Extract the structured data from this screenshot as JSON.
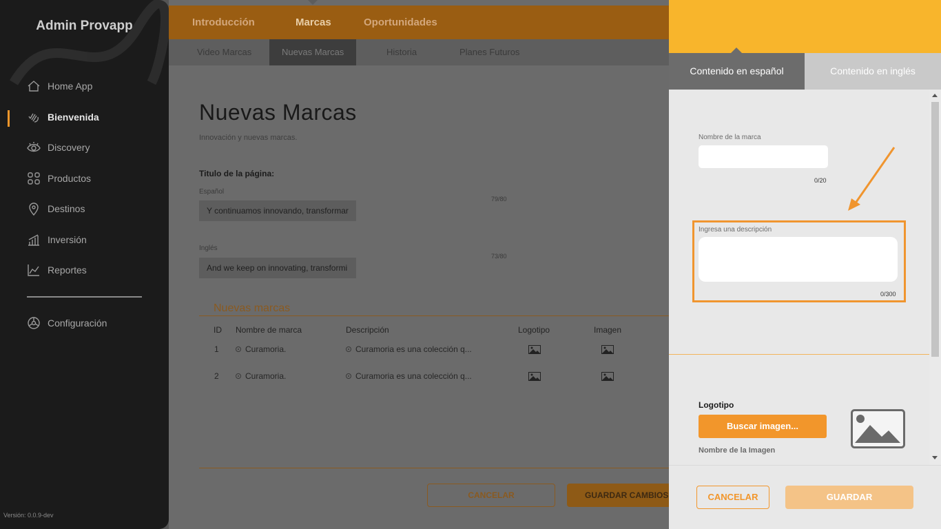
{
  "sidebar": {
    "app_title": "Admin Provapp",
    "items": [
      {
        "label": "Home App",
        "icon": "home-icon"
      },
      {
        "label": "Bienvenida",
        "icon": "wave-hand-icon",
        "active": true
      },
      {
        "label": "Discovery",
        "icon": "eye-icon"
      },
      {
        "label": "Productos",
        "icon": "grid-icon"
      },
      {
        "label": "Destinos",
        "icon": "map-pin-icon"
      },
      {
        "label": "Inversión",
        "icon": "bar-chart-icon"
      },
      {
        "label": "Reportes",
        "icon": "line-chart-icon"
      },
      {
        "label": "Configuración",
        "icon": "gear-icon"
      }
    ],
    "version": "Versión: 0.0.9-dev"
  },
  "topnav": {
    "tabs": [
      "Introducción",
      "Marcas",
      "Oportunidades"
    ],
    "active": "Marcas"
  },
  "subnav": {
    "tabs": [
      "Video Marcas",
      "Nuevas Marcas",
      "Historia",
      "Planes Futuros"
    ],
    "active": "Nuevas Marcas"
  },
  "page": {
    "title": "Nuevas Marcas",
    "subtitle": "Innovación y nuevas marcas.",
    "page_title_label": "Titulo de la página:",
    "spanish_label": "Español",
    "spanish_value": "Y continuamos innovando, transformar",
    "spanish_counter": "79/80",
    "english_label": "Inglés",
    "english_value": "And we keep on innovating, transformi",
    "english_counter": "73/80",
    "section_title": "Nuevas marcas",
    "table": {
      "headers": [
        "ID",
        "Nombre de marca",
        "Descripción",
        "Logotipo",
        "Imagen"
      ],
      "rows": [
        {
          "id": "1",
          "name": "Curamoria.",
          "description": "Curamoria es una colección q..."
        },
        {
          "id": "2",
          "name": "Curamoria.",
          "description": "Curamoria es una colección q..."
        }
      ]
    },
    "cancel_label": "CANCELAR",
    "save_label": "GUARDAR CAMBIOS"
  },
  "panel": {
    "tab_es": "Contenido en español",
    "tab_en": "Contenido en inglés",
    "brand_name_label": "Nombre de la marca",
    "brand_name_value": "",
    "brand_name_counter": "0/20",
    "description_label": "Ingresa una descripción",
    "description_value": "",
    "description_counter": "0/300",
    "logo_label": "Logotipo",
    "search_image_label": "Buscar imagen...",
    "image_name_label": "Nombre de la Imagen",
    "cancel_label": "CANCELAR",
    "save_label": "GUARDAR"
  },
  "colors": {
    "accent": "#f2962b",
    "panel_header": "#f8b52c",
    "highlight": "#f0952f"
  }
}
